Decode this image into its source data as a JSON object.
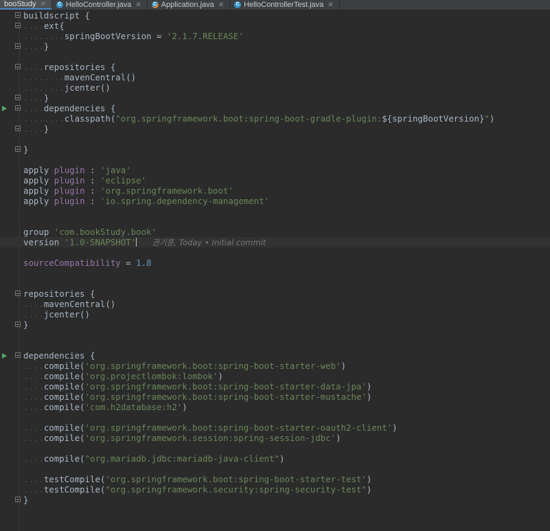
{
  "tabs": [
    {
      "label": "booStudy",
      "active": true,
      "icon": "gradle-icon"
    },
    {
      "label": "HelloController.java",
      "active": false,
      "icon": "java-class-icon"
    },
    {
      "label": "Application.java",
      "active": false,
      "icon": "java-app-class-icon"
    },
    {
      "label": "HelloControllerTest.java",
      "active": false,
      "icon": "java-class-icon"
    }
  ],
  "editor": {
    "buildscript_kw": "buildscript {",
    "ext_kw": "ext{",
    "springBootVersion_assign": "springBootVersion = ",
    "springBootVersion_value": "'2.1.7.RELEASE'",
    "close_brace": "}",
    "repositories_kw": "repositories {",
    "mavenCentral": "mavenCentral()",
    "jcenter": "jcenter()",
    "dependencies_kw": "dependencies {",
    "classpath_kw": "classpath(",
    "classpath_str_a": "\"org.springframework.boot:spring-boot-gradle-plugin:",
    "classpath_interp": "${springBootVersion}",
    "classpath_str_b": "\"",
    "classpath_close": ")",
    "apply_kw": "apply",
    "plugin_kw": "plugin",
    "colon": " : ",
    "plugins": [
      "'java'",
      "'eclipse'",
      "'org.springframework.boot'",
      "'io.spring.dependency-management'"
    ],
    "group_kw": "group ",
    "group_value": "'com.bookStudy.book'",
    "version_kw": "version ",
    "version_value": "'1.0-SNAPSHOT'",
    "blame_annotation": "권기훈, Today • Initial commit",
    "sourceCompat_kw": "sourceCompatibility",
    "sourceCompat_eq": " = ",
    "sourceCompat_value": "1.8",
    "compile_kw": "compile(",
    "testCompile_kw": "testCompile(",
    "paren_close": ")",
    "deps": [
      "'org.springframework.boot:spring-boot-starter-web'",
      "'org.projectlombok:lombok'",
      "'org.springframework.boot:spring-boot-starter-data-jpa'",
      "'org.springframework.boot:spring-boot-starter-mustache'",
      "'com.h2database:h2'",
      "'org.springframework.boot:spring-boot-starter-oauth2-client'",
      "'org.springframework.session:spring-session-jdbc'",
      "\"org.mariadb.jdbc:mariadb-java-client\"",
      "'org.springframework.boot:spring-boot-starter-test'",
      "\"org.springframework.security:spring-security-test\""
    ]
  },
  "colors": {
    "background": "#2b2b2b",
    "string": "#6a8759",
    "number": "#6897bb",
    "property": "#9876aa",
    "default_text": "#a9b7c6",
    "run_marker": "#59a869"
  }
}
